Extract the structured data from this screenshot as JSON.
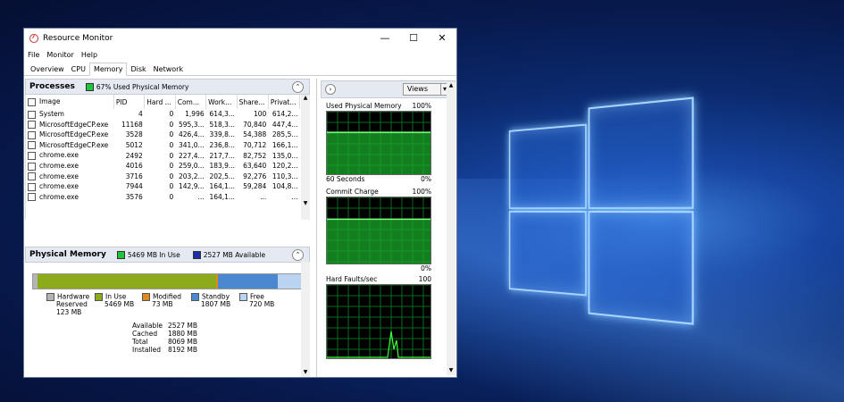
{
  "window": {
    "title": "Resource Monitor",
    "controls": {
      "minimize": "—",
      "maximize": "☐",
      "close": "✕"
    }
  },
  "menu": [
    "File",
    "Monitor",
    "Help"
  ],
  "tabs": [
    "Overview",
    "CPU",
    "Memory",
    "Disk",
    "Network"
  ],
  "active_tab": "Memory",
  "processes": {
    "title": "Processes",
    "summary": "67% Used Physical Memory",
    "summary_color": "#22c43a",
    "columns": [
      "Image",
      "PID",
      "Hard ...",
      "Com...",
      "Work...",
      "Share...",
      "Privat..."
    ],
    "rows": [
      [
        "System",
        "4",
        "0",
        "1,996",
        "614,3...",
        "100",
        "614,2..."
      ],
      [
        "MicrosoftEdgeCP.exe",
        "11168",
        "0",
        "595,3...",
        "518,3...",
        "70,840",
        "447,4..."
      ],
      [
        "MicrosoftEdgeCP.exe",
        "3528",
        "0",
        "426,4...",
        "339,8...",
        "54,388",
        "285,5..."
      ],
      [
        "MicrosoftEdgeCP.exe",
        "5012",
        "0",
        "341,0...",
        "236,8...",
        "70,712",
        "166,1..."
      ],
      [
        "chrome.exe",
        "2492",
        "0",
        "227,4...",
        "217,7...",
        "82,752",
        "135,0..."
      ],
      [
        "chrome.exe",
        "4016",
        "0",
        "259,0...",
        "183,9...",
        "63,640",
        "120,2..."
      ],
      [
        "chrome.exe",
        "3716",
        "0",
        "203,2...",
        "202,5...",
        "92,276",
        "110,3..."
      ],
      [
        "chrome.exe",
        "7944",
        "0",
        "142,9...",
        "164,1...",
        "59,284",
        "104,8..."
      ],
      [
        "chrome.exe",
        "3576",
        "0",
        "...",
        "164,1...",
        "...",
        "..."
      ]
    ]
  },
  "physical_memory": {
    "title": "Physical Memory",
    "in_use_label": "5469 MB In Use",
    "available_label": "2527 MB Available",
    "in_use_color": "#22c43a",
    "available_color": "#1a2fa8",
    "bar": {
      "hardware_reserved_mb": 123,
      "in_use_mb": 5469,
      "modified_mb": 73,
      "standby_mb": 1807,
      "free_mb": 720
    },
    "legend": [
      {
        "label": "Hardware Reserved",
        "value": "123 MB",
        "color": "#b4b4b4"
      },
      {
        "label": "In Use",
        "value": "5469 MB",
        "color": "#8caa1a"
      },
      {
        "label": "Modified",
        "value": "73 MB",
        "color": "#e08a1e"
      },
      {
        "label": "Standby",
        "value": "1807 MB",
        "color": "#4a88d0"
      },
      {
        "label": "Free",
        "value": "720 MB",
        "color": "#b9d3f0"
      }
    ],
    "stats": [
      {
        "label": "Available",
        "value": "2527 MB"
      },
      {
        "label": "Cached",
        "value": "1880 MB"
      },
      {
        "label": "Total",
        "value": "8069 MB"
      },
      {
        "label": "Installed",
        "value": "8192 MB"
      }
    ]
  },
  "right_panel": {
    "views_label": "Views",
    "graphs": [
      {
        "title": "Used Physical Memory",
        "max": "100%",
        "foot_left": "60 Seconds",
        "foot_right": "0%",
        "level_percent": 67
      },
      {
        "title": "Commit Charge",
        "max": "100%",
        "foot_left": "",
        "foot_right": "0%",
        "level_percent": 67
      },
      {
        "title": "Hard Faults/sec",
        "max": "100",
        "foot_left": "",
        "foot_right": "0",
        "level_percent": 0
      }
    ]
  }
}
